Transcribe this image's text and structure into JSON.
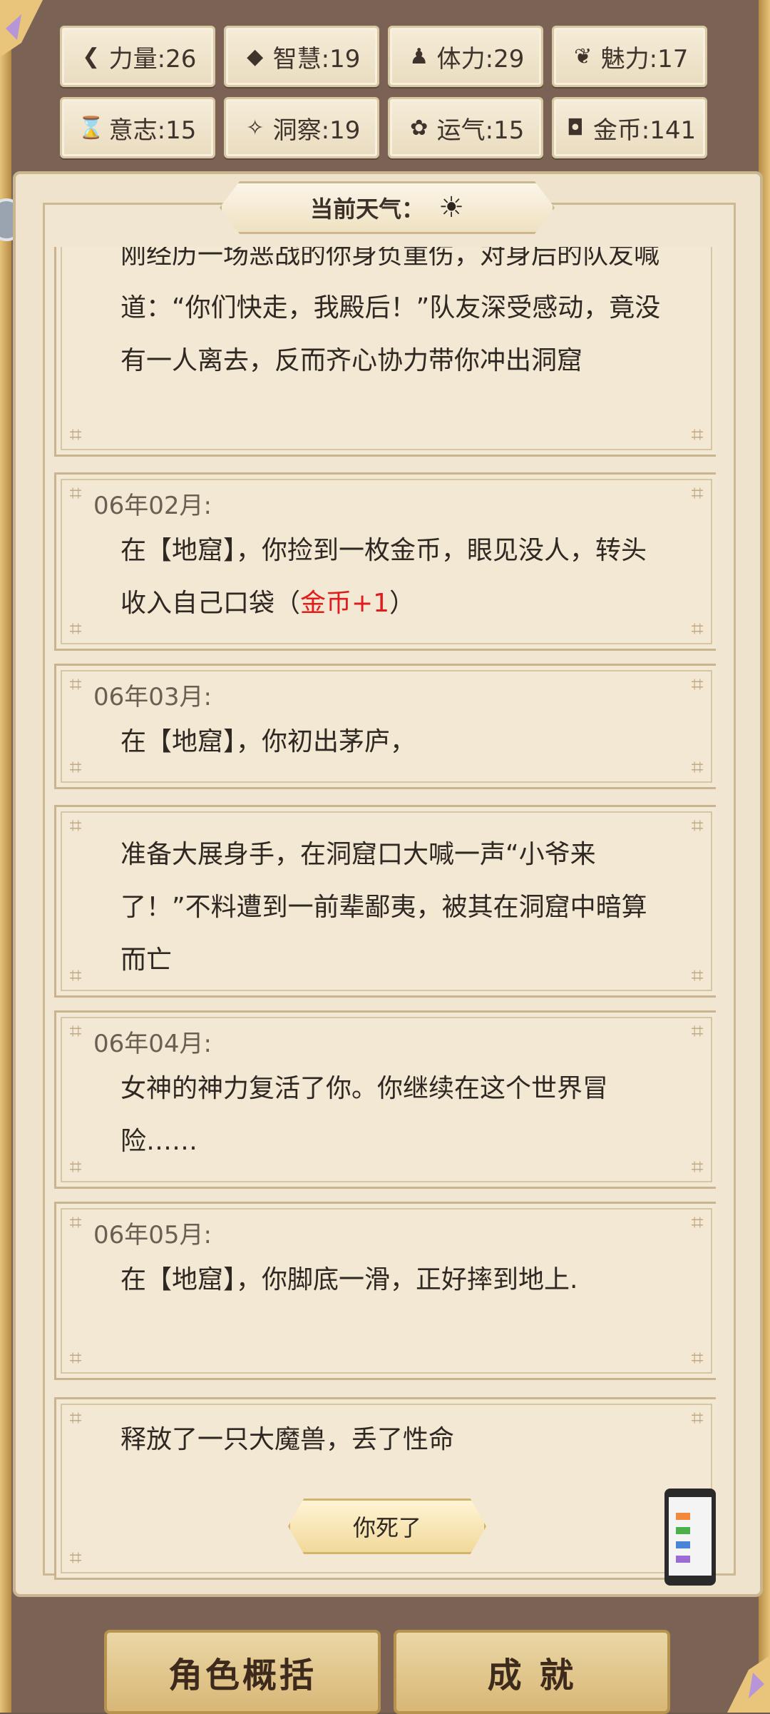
{
  "stats": [
    {
      "icon": "strength-icon",
      "glyph": "❮",
      "label": "力量:26"
    },
    {
      "icon": "wisdom-icon",
      "glyph": "◆",
      "label": "智慧:19"
    },
    {
      "icon": "stamina-icon",
      "glyph": "♟",
      "label": "体力:29"
    },
    {
      "icon": "charm-icon",
      "glyph": "❦",
      "label": "魅力:17"
    },
    {
      "icon": "will-icon",
      "glyph": "⌛",
      "label": "意志:15"
    },
    {
      "icon": "insight-icon",
      "glyph": "✧",
      "label": "洞察:19"
    },
    {
      "icon": "luck-icon",
      "glyph": "✿",
      "label": "运气:15"
    },
    {
      "icon": "gold-icon",
      "glyph": "◘",
      "label": "金币:141"
    }
  ],
  "weather": {
    "label": "当前天气：",
    "icon": "sun-icon",
    "glyph": "☀"
  },
  "log": [
    {
      "date": "",
      "text": "刚经历一场恶战的你身负重伤，对身后的队友喊道：“你们快走，我殿后！”队友深受感动，竟没有一人离去，反而齐心协力带你冲出洞窟"
    },
    {
      "date": "06年02月:",
      "text": "在【地窟】，你捡到一枚金币，眼见没人，转头收入自己口袋（",
      "reward": "金币+1",
      "suffix": "）"
    },
    {
      "date": "06年03月:",
      "text": "在【地窟】，你初出茅庐，"
    },
    {
      "date": "",
      "text": "准备大展身手，在洞窟口大喊一声“小爷来了！”不料遭到一前辈鄙夷，被其在洞窟中暗算而亡"
    },
    {
      "date": "06年04月:",
      "text": "女神的神力复活了你。你继续在这个世界冒险……"
    },
    {
      "date": "06年05月:",
      "text": "在【地窟】，你脚底一滑，正好摔到地上."
    },
    {
      "date": "",
      "text": "释放了一只大魔兽，丢了性命"
    }
  ],
  "died_button": "你死了",
  "bottom": {
    "summary": "角色概括",
    "achievements": "成 就"
  },
  "colors": {
    "reward": "#e01c1c",
    "panel": "#f3e8d3",
    "frame": "#7a6254"
  }
}
